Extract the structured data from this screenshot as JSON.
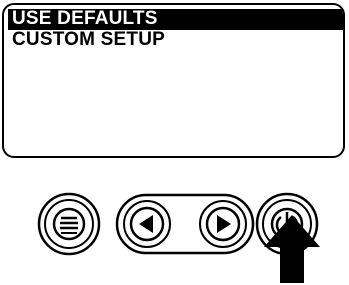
{
  "menu": {
    "items": [
      {
        "label": "USE DEFAULTS",
        "selected": true
      },
      {
        "label": "CUSTOM SETUP",
        "selected": false
      }
    ]
  },
  "buttons": {
    "menu": {
      "icon": "menu-lines-icon"
    },
    "left": {
      "icon": "left-arrow-icon"
    },
    "right": {
      "icon": "right-arrow-icon"
    },
    "power": {
      "icon": "power-icon"
    }
  },
  "pointer": {
    "icon": "pointer-arrow-icon"
  },
  "colors": {
    "foreground": "#000000",
    "background": "#ffffff"
  }
}
